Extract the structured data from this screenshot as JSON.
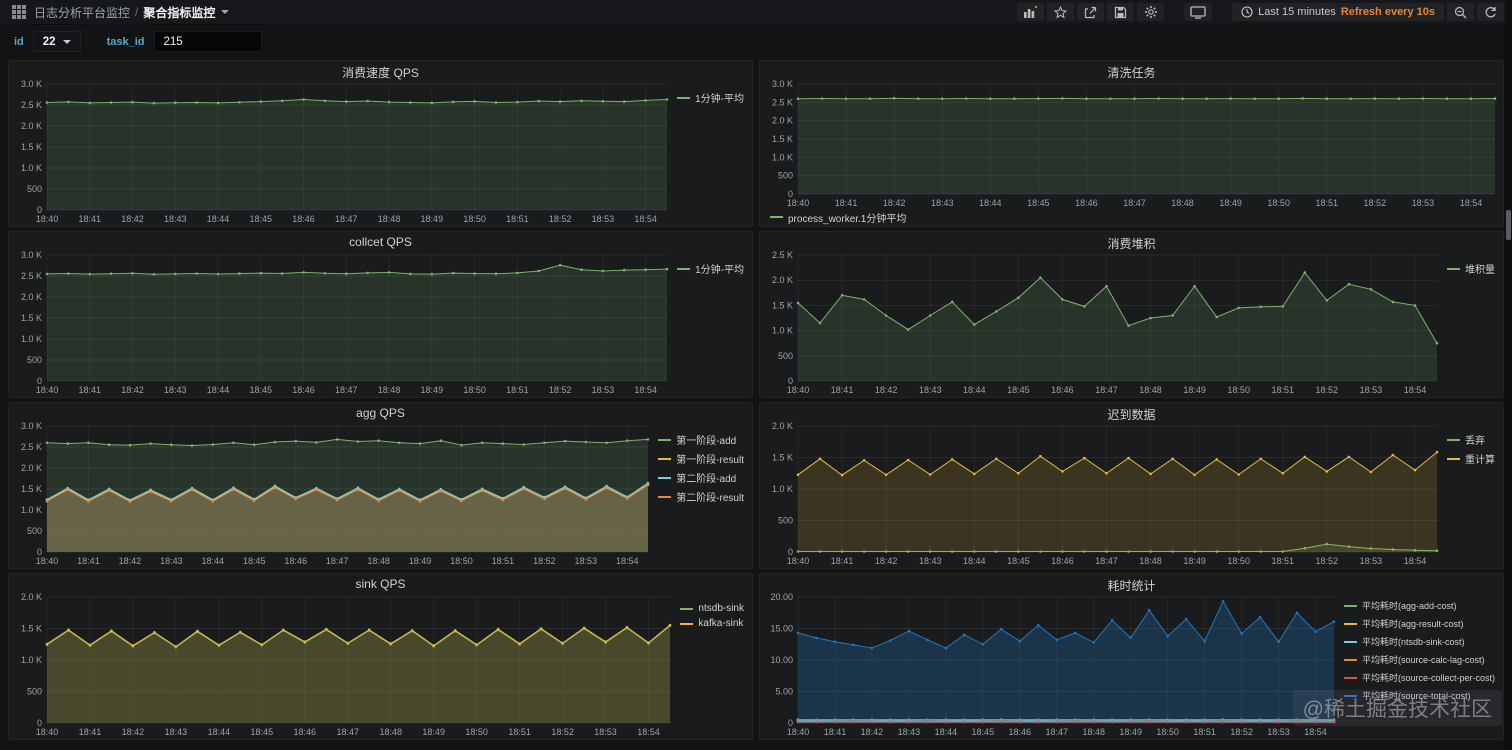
{
  "navbar": {
    "breadcrumb_parent": "日志分析平台监控",
    "breadcrumb_separator": "/",
    "breadcrumb_current": "聚合指标监控",
    "time_range": "Last 15 minutes",
    "refresh_text": "Refresh every 10s",
    "accent_orange": "#eb842f"
  },
  "variables": {
    "id": {
      "label": "id",
      "value": "22"
    },
    "task_id": {
      "label": "task_id",
      "value": "215"
    }
  },
  "watermark": "@稀土掘金技术社区",
  "palette": {
    "green": "#7EB26D",
    "yellow": "#EAB839",
    "cyan": "#6ED0E0",
    "orange": "#EF843C",
    "red": "#E24D42",
    "blue": "#1F78C1"
  },
  "chart_data": [
    {
      "type": "line",
      "title": "消费速度 QPS",
      "legend_position": "right",
      "ylim": [
        0,
        3000
      ],
      "y_ticks": [
        "0",
        "500",
        "1.0 K",
        "1.5 K",
        "2.0 K",
        "2.5 K",
        "3.0 K"
      ],
      "x_ticks": [
        "18:40",
        "18:41",
        "18:42",
        "18:43",
        "18:44",
        "18:45",
        "18:46",
        "18:47",
        "18:48",
        "18:49",
        "18:50",
        "18:51",
        "18:52",
        "18:53",
        "18:54"
      ],
      "series": [
        {
          "name": "1分钟-平均",
          "color": "#7EB26D",
          "values": [
            2560,
            2575,
            2550,
            2560,
            2570,
            2545,
            2555,
            2560,
            2550,
            2565,
            2580,
            2600,
            2630,
            2600,
            2580,
            2595,
            2570,
            2560,
            2550,
            2575,
            2585,
            2560,
            2570,
            2595,
            2580,
            2600,
            2590,
            2580,
            2610,
            2630
          ]
        }
      ]
    },
    {
      "type": "line",
      "title": "清洗任务",
      "legend_position": "bottom",
      "ylim": [
        0,
        3000
      ],
      "y_ticks": [
        "0",
        "500",
        "1.0 K",
        "1.5 K",
        "2.0 K",
        "2.5 K",
        "3.0 K"
      ],
      "x_ticks": [
        "18:40",
        "18:41",
        "18:42",
        "18:43",
        "18:44",
        "18:45",
        "18:46",
        "18:47",
        "18:48",
        "18:49",
        "18:50",
        "18:51",
        "18:52",
        "18:53",
        "18:54"
      ],
      "series": [
        {
          "name": "process_worker.1分钟平均",
          "color": "#7EB26D",
          "values": [
            2600,
            2605,
            2595,
            2600,
            2610,
            2600,
            2595,
            2605,
            2600,
            2598,
            2602,
            2608,
            2600,
            2595,
            2600,
            2605,
            2598,
            2600,
            2603,
            2597,
            2600,
            2606,
            2600,
            2595,
            2602,
            2600,
            2605,
            2600,
            2598,
            2604
          ]
        }
      ]
    },
    {
      "type": "line",
      "title": "collcet QPS",
      "legend_position": "right",
      "ylim": [
        0,
        3000
      ],
      "y_ticks": [
        "0",
        "500",
        "1.0 K",
        "1.5 K",
        "2.0 K",
        "2.5 K",
        "3.0 K"
      ],
      "x_ticks": [
        "18:40",
        "18:41",
        "18:42",
        "18:43",
        "18:44",
        "18:45",
        "18:46",
        "18:47",
        "18:48",
        "18:49",
        "18:50",
        "18:51",
        "18:52",
        "18:53",
        "18:54"
      ],
      "series": [
        {
          "name": "1分钟-平均",
          "color": "#7EB26D",
          "values": [
            2550,
            2560,
            2545,
            2555,
            2565,
            2540,
            2550,
            2560,
            2548,
            2558,
            2570,
            2560,
            2585,
            2565,
            2555,
            2575,
            2585,
            2550,
            2545,
            2570,
            2560,
            2555,
            2575,
            2620,
            2760,
            2650,
            2620,
            2640,
            2650,
            2665
          ]
        }
      ]
    },
    {
      "type": "line",
      "title": "消费堆积",
      "legend_position": "right",
      "ylim": [
        0,
        2500
      ],
      "y_ticks": [
        "0",
        "500",
        "1.0 K",
        "1.5 K",
        "2.0 K",
        "2.5 K"
      ],
      "x_ticks": [
        "18:40",
        "18:41",
        "18:42",
        "18:43",
        "18:44",
        "18:45",
        "18:46",
        "18:47",
        "18:48",
        "18:49",
        "18:50",
        "18:51",
        "18:52",
        "18:53",
        "18:54"
      ],
      "series": [
        {
          "name": "堆积量",
          "color": "#7EB26D",
          "values": [
            1550,
            1150,
            1700,
            1620,
            1300,
            1020,
            1300,
            1570,
            1120,
            1380,
            1650,
            2050,
            1620,
            1480,
            1880,
            1100,
            1250,
            1300,
            1880,
            1270,
            1450,
            1470,
            1480,
            2150,
            1600,
            1920,
            1820,
            1570,
            1500,
            750
          ]
        }
      ]
    },
    {
      "type": "line",
      "title": "agg QPS",
      "legend_position": "right",
      "ylim": [
        0,
        3000
      ],
      "y_ticks": [
        "0",
        "500",
        "1.0 K",
        "1.5 K",
        "2.0 K",
        "2.5 K",
        "3.0 K"
      ],
      "x_ticks": [
        "18:40",
        "18:41",
        "18:42",
        "18:43",
        "18:44",
        "18:45",
        "18:46",
        "18:47",
        "18:48",
        "18:49",
        "18:50",
        "18:51",
        "18:52",
        "18:53",
        "18:54"
      ],
      "series": [
        {
          "name": "第一阶段-add",
          "color": "#7EB26D",
          "values": [
            2600,
            2580,
            2600,
            2555,
            2545,
            2580,
            2555,
            2535,
            2560,
            2600,
            2555,
            2620,
            2640,
            2610,
            2680,
            2630,
            2650,
            2600,
            2580,
            2650,
            2545,
            2600,
            2580,
            2560,
            2600,
            2640,
            2620,
            2600,
            2650,
            2680
          ]
        },
        {
          "name": "第一阶段-result",
          "color": "#EAB839",
          "values": [
            1230,
            1500,
            1225,
            1480,
            1220,
            1455,
            1230,
            1500,
            1225,
            1505,
            1240,
            1550,
            1280,
            1500,
            1255,
            1505,
            1240,
            1480,
            1225,
            1470,
            1235,
            1480,
            1260,
            1520,
            1285,
            1530,
            1270,
            1545,
            1295,
            1615
          ]
        },
        {
          "name": "第二阶段-add",
          "color": "#6ED0E0",
          "values": [
            1250,
            1525,
            1245,
            1505,
            1240,
            1480,
            1250,
            1525,
            1245,
            1530,
            1260,
            1575,
            1300,
            1525,
            1275,
            1530,
            1260,
            1505,
            1245,
            1495,
            1255,
            1505,
            1280,
            1545,
            1305,
            1555,
            1290,
            1570,
            1315,
            1640
          ]
        },
        {
          "name": "第二阶段-result",
          "color": "#EF843C",
          "values": [
            1210,
            1480,
            1205,
            1460,
            1200,
            1435,
            1210,
            1480,
            1205,
            1485,
            1220,
            1530,
            1260,
            1480,
            1235,
            1485,
            1220,
            1460,
            1205,
            1450,
            1215,
            1460,
            1240,
            1500,
            1265,
            1510,
            1250,
            1525,
            1275,
            1595
          ]
        }
      ]
    },
    {
      "type": "line",
      "title": "迟到数据",
      "legend_position": "right",
      "ylim": [
        0,
        2000
      ],
      "y_ticks": [
        "0",
        "500",
        "1.0 K",
        "1.5 K",
        "2.0 K"
      ],
      "x_ticks": [
        "18:40",
        "18:41",
        "18:42",
        "18:43",
        "18:44",
        "18:45",
        "18:46",
        "18:47",
        "18:48",
        "18:49",
        "18:50",
        "18:51",
        "18:52",
        "18:53",
        "18:54"
      ],
      "series": [
        {
          "name": "丢弃",
          "color": "#7EB26D",
          "values": [
            8,
            8,
            8,
            8,
            8,
            8,
            8,
            8,
            8,
            8,
            8,
            8,
            8,
            8,
            8,
            8,
            8,
            8,
            8,
            8,
            8,
            8,
            8,
            60,
            125,
            85,
            55,
            40,
            28,
            20
          ]
        },
        {
          "name": "重计算",
          "color": "#EAB839",
          "values": [
            1225,
            1480,
            1220,
            1455,
            1225,
            1460,
            1230,
            1470,
            1240,
            1480,
            1250,
            1520,
            1280,
            1490,
            1250,
            1490,
            1240,
            1480,
            1225,
            1470,
            1230,
            1480,
            1250,
            1510,
            1280,
            1510,
            1270,
            1540,
            1300,
            1585
          ]
        }
      ]
    },
    {
      "type": "line",
      "title": "sink QPS",
      "legend_position": "right",
      "ylim": [
        0,
        2000
      ],
      "y_ticks": [
        "0",
        "500",
        "1.0 K",
        "1.5 K",
        "2.0 K"
      ],
      "x_ticks": [
        "18:40",
        "18:41",
        "18:42",
        "18:43",
        "18:44",
        "18:45",
        "18:46",
        "18:47",
        "18:48",
        "18:49",
        "18:50",
        "18:51",
        "18:52",
        "18:53",
        "18:54"
      ],
      "series": [
        {
          "name": "ntsdb-sink",
          "color": "#7EB26D",
          "values": [
            1243,
            1468,
            1228,
            1453,
            1218,
            1428,
            1203,
            1448,
            1228,
            1433,
            1233,
            1468,
            1278,
            1478,
            1258,
            1468,
            1248,
            1458,
            1218,
            1458,
            1233,
            1478,
            1248,
            1488,
            1258,
            1498,
            1278,
            1508,
            1263,
            1543
          ]
        },
        {
          "name": "kafka-sink",
          "color": "#EAB839",
          "values": [
            1255,
            1480,
            1240,
            1465,
            1230,
            1440,
            1215,
            1460,
            1240,
            1445,
            1245,
            1480,
            1290,
            1490,
            1270,
            1480,
            1260,
            1470,
            1230,
            1470,
            1245,
            1490,
            1260,
            1500,
            1270,
            1510,
            1290,
            1520,
            1275,
            1555
          ]
        }
      ]
    },
    {
      "type": "line",
      "title": "耗时统计",
      "legend_position": "right",
      "ylim": [
        0,
        20
      ],
      "y_ticks": [
        "0",
        "5.00",
        "10.00",
        "15.00",
        "20.00"
      ],
      "x_ticks": [
        "18:40",
        "18:41",
        "18:42",
        "18:43",
        "18:44",
        "18:45",
        "18:46",
        "18:47",
        "18:48",
        "18:49",
        "18:50",
        "18:51",
        "18:52",
        "18:53",
        "18:54"
      ],
      "series": [
        {
          "name": "平均耗时(agg-add-cost)",
          "color": "#7EB26D",
          "values": [
            0.3,
            0.3,
            0.3,
            0.3,
            0.3,
            0.3,
            0.3,
            0.3,
            0.3,
            0.3,
            0.3,
            0.3,
            0.3,
            0.3,
            0.3,
            0.3,
            0.3,
            0.3,
            0.3,
            0.3,
            0.3,
            0.3,
            0.3,
            0.3,
            0.3,
            0.3,
            0.3,
            0.3,
            0.3,
            0.3
          ]
        },
        {
          "name": "平均耗时(agg-result-cost)",
          "color": "#EAB839",
          "values": [
            0.2,
            0.2,
            0.2,
            0.2,
            0.2,
            0.2,
            0.2,
            0.2,
            0.2,
            0.2,
            0.2,
            0.2,
            0.2,
            0.2,
            0.2,
            0.2,
            0.2,
            0.2,
            0.2,
            0.2,
            0.2,
            0.2,
            0.2,
            0.2,
            0.2,
            0.2,
            0.2,
            0.2,
            0.2,
            0.2
          ]
        },
        {
          "name": "平均耗时(ntsdb-sink-cost)",
          "color": "#6ED0E0",
          "values": [
            0.45,
            0.4,
            0.45,
            0.5,
            0.45,
            0.4,
            0.45,
            0.5,
            0.45,
            0.4,
            0.45,
            0.5,
            0.45,
            0.4,
            0.45,
            0.5,
            0.45,
            0.4,
            0.45,
            0.5,
            0.45,
            0.4,
            0.45,
            0.5,
            0.45,
            0.4,
            0.45,
            0.5,
            0.45,
            0.4
          ]
        },
        {
          "name": "平均耗时(source-calc-lag-cost)",
          "color": "#EF843C",
          "values": [
            0.55,
            0.55,
            0.55,
            0.55,
            0.55,
            0.55,
            0.55,
            0.55,
            0.55,
            0.55,
            0.55,
            0.55,
            0.55,
            0.55,
            0.55,
            0.55,
            0.55,
            0.55,
            0.55,
            0.55,
            0.55,
            0.55,
            0.55,
            0.55,
            0.55,
            0.55,
            0.55,
            0.55,
            0.55,
            0.55
          ]
        },
        {
          "name": "平均耗时(source-collect-per-cost)",
          "color": "#E24D42",
          "values": [
            0.15,
            0.15,
            0.15,
            0.15,
            0.15,
            0.15,
            0.15,
            0.15,
            0.15,
            0.15,
            0.15,
            0.15,
            0.15,
            0.15,
            0.15,
            0.15,
            0.15,
            0.15,
            0.15,
            0.15,
            0.15,
            0.15,
            0.15,
            0.15,
            0.15,
            0.15,
            0.15,
            0.15,
            0.15,
            0.15
          ]
        },
        {
          "name": "平均耗时(source-total-cost)",
          "color": "#1F78C1",
          "fill_opacity": 0.28,
          "values": [
            14.3,
            13.5,
            12.9,
            12.4,
            11.9,
            13.1,
            14.6,
            13.2,
            11.9,
            14.0,
            12.5,
            14.9,
            13.0,
            15.5,
            13.2,
            14.3,
            12.8,
            16.3,
            13.5,
            17.9,
            13.8,
            16.5,
            13.0,
            19.3,
            14.2,
            16.8,
            12.9,
            17.5,
            14.5,
            16.1
          ]
        }
      ]
    }
  ]
}
